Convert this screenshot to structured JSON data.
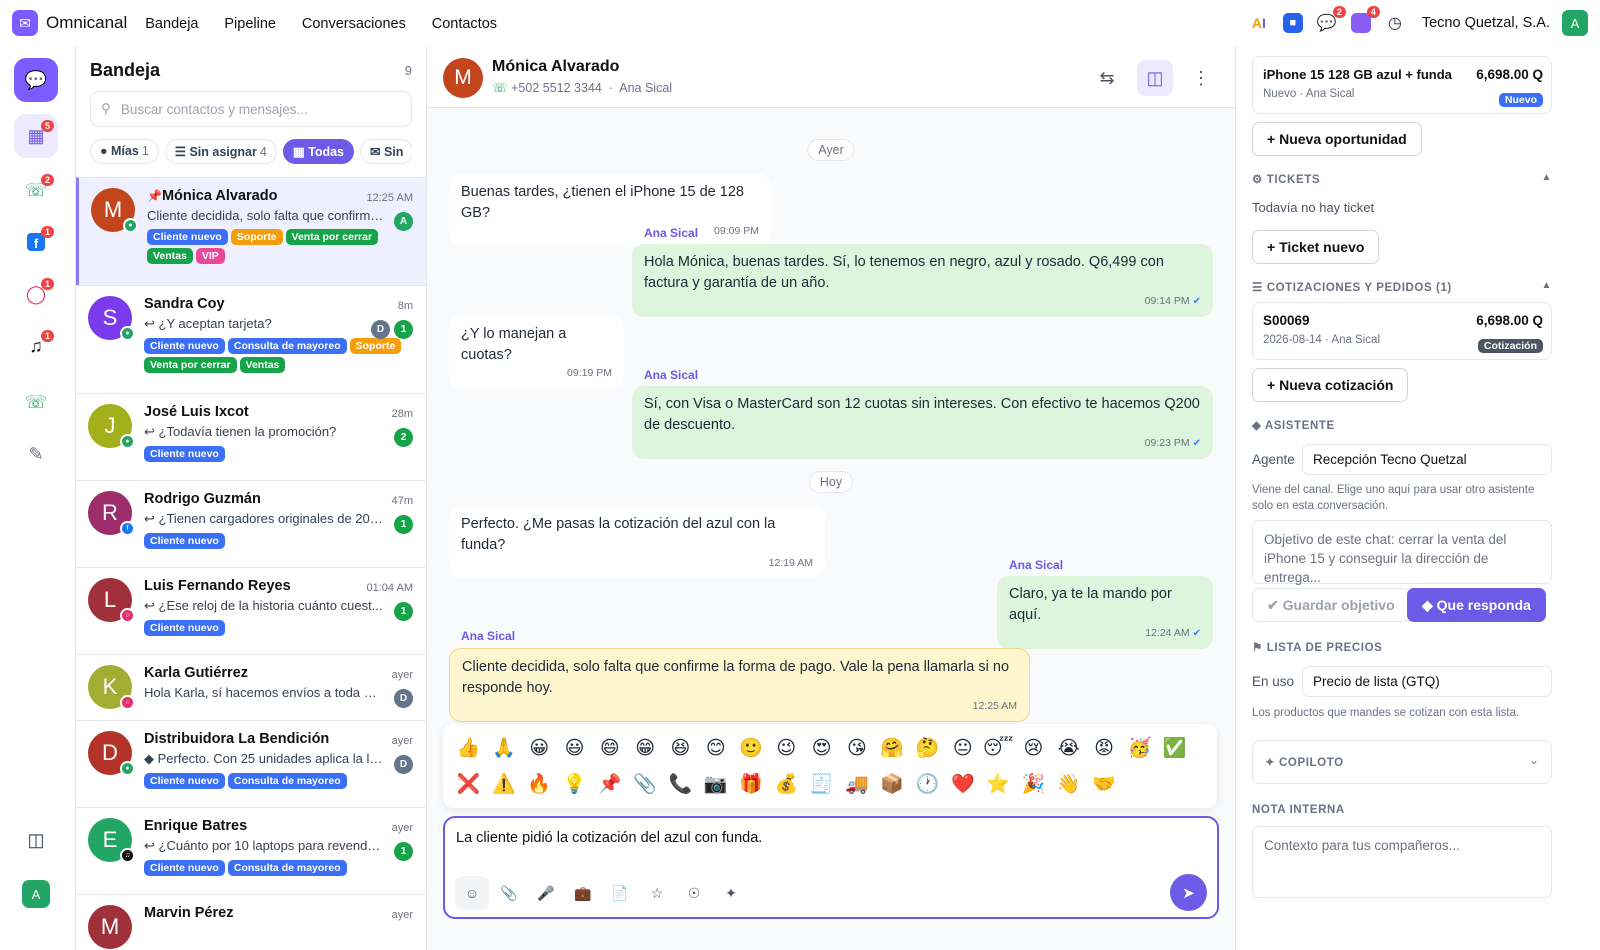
{
  "topbar": {
    "brand": "Omnicanal",
    "nav": [
      "Bandeja",
      "Pipeline",
      "Conversaciones",
      "Contactos"
    ],
    "chat_badge": "2",
    "inbox_badge": "4",
    "org": "Tecno Quetzal, S.A.",
    "user_initial": "A"
  },
  "rail": {
    "dashboard_badge": "5",
    "whatsapp_badge": "2",
    "facebook_badge": "1",
    "instagram_badge": "1",
    "tiktok_badge": "1",
    "user_initial": "A"
  },
  "inbox": {
    "title": "Bandeja",
    "count": "9",
    "search_placeholder": "Buscar contactos y mensajes...",
    "filters": [
      {
        "label": "Mías",
        "n": "1"
      },
      {
        "label": "Sin asignar",
        "n": "4"
      },
      {
        "label": "Todas",
        "n": ""
      },
      {
        "label": "Sin",
        "n": ""
      }
    ],
    "conversations": [
      {
        "initial": "M",
        "name": "Mónica Alvarado",
        "time": "12:25 AM",
        "preview": "Cliente decidida, solo falta que confirme...",
        "badges": [
          "A"
        ],
        "tags": [
          "Cliente nuevo",
          "Soporte",
          "Venta por cerrar",
          "Ventas",
          "VIP"
        ]
      },
      {
        "initial": "S",
        "name": "Sandra Coy",
        "time": "8m",
        "preview": "¿Y aceptan tarjeta?",
        "badges": [
          "D",
          "1"
        ],
        "tags": [
          "Cliente nuevo",
          "Consulta de mayoreo",
          "Soporte",
          "Venta por cerrar",
          "Ventas"
        ]
      },
      {
        "initial": "J",
        "name": "José Luis Ixcot",
        "time": "28m",
        "preview": "¿Todavía tienen la promoción?",
        "badges": [
          "2"
        ],
        "tags": [
          "Cliente nuevo"
        ]
      },
      {
        "initial": "R",
        "name": "Rodrigo Guzmán",
        "time": "47m",
        "preview": "¿Tienen cargadores originales de 20 ...",
        "badges": [
          "1"
        ],
        "tags": [
          "Cliente nuevo"
        ]
      },
      {
        "initial": "L",
        "name": "Luis Fernando Reyes",
        "time": "01:04 AM",
        "preview": "¿Ese reloj de la historia cuánto cuest...",
        "badges": [
          "1"
        ],
        "tags": [
          "Cliente nuevo"
        ]
      },
      {
        "initial": "K",
        "name": "Karla Gutiérrez",
        "time": "ayer",
        "preview": "Hola Karla, sí hacemos envíos a toda Gu...",
        "badges": [
          "D"
        ],
        "tags": []
      },
      {
        "initial": "D",
        "name": "Distribuidora La Bendición",
        "time": "ayer",
        "preview": "Perfecto. Con 25 unidades aplica la lis...",
        "badges": [
          "D"
        ],
        "tags": [
          "Cliente nuevo",
          "Consulta de mayoreo"
        ]
      },
      {
        "initial": "E",
        "name": "Enrique Batres",
        "time": "ayer",
        "preview": "¿Cuánto por 10 laptops para revende...",
        "badges": [
          "1"
        ],
        "tags": [
          "Cliente nuevo",
          "Consulta de mayoreo"
        ]
      },
      {
        "initial": "M",
        "name": "Marvin Pérez",
        "time": "ayer",
        "preview": "",
        "badges": [],
        "tags": []
      }
    ]
  },
  "chat": {
    "contact_initial": "M",
    "contact_name": "Mónica Alvarado",
    "phone": "+502 5512 3344",
    "agent": "Ana Sical",
    "sep": "·",
    "day1": "Ayer",
    "day2": "Hoy",
    "messages": [
      {
        "text": "Buenas tardes, ¿tienen el iPhone 15 de 128 GB?",
        "time": "09:09 PM"
      },
      {
        "sender": "Ana Sical",
        "text": "Hola Mónica, buenas tardes. Sí, lo tenemos en negro, azul y rosado. Q6,499 con factura y garantía de un año.",
        "time": "09:14 PM"
      },
      {
        "text": "¿Y lo manejan a cuotas?",
        "time": "09:19 PM"
      },
      {
        "sender": "Ana Sical",
        "text": "Sí, con Visa o MasterCard son 12 cuotas sin intereses. Con efectivo te hacemos Q200 de descuento.",
        "time": "09:23 PM"
      },
      {
        "text": "Perfecto. ¿Me pasas la cotización del azul con la funda?",
        "time": "12:19 AM"
      },
      {
        "sender": "Ana Sical",
        "text": "Claro, ya te la mando por aquí.",
        "time": "12:24 AM"
      },
      {
        "sender": "Ana Sical",
        "text": "Cliente decidida, solo falta que confirme la forma de pago. Vale la pena llamarla si no responde hoy.",
        "time": "12:25 AM"
      }
    ],
    "emojis": [
      "👍",
      "🙏",
      "😀",
      "😃",
      "😄",
      "😁",
      "😆",
      "😊",
      "🙂",
      "😉",
      "😍",
      "😘",
      "🤗",
      "🤔",
      "😐",
      "😴",
      "😢",
      "😭",
      "😡",
      "🥳",
      "✅",
      "❌",
      "⚠️",
      "🔥",
      "💡",
      "📌",
      "📎",
      "📞",
      "📷",
      "🎁",
      "💰",
      "🧾",
      "🚚",
      "📦",
      "🕐",
      "❤️",
      "⭐",
      "🎉",
      "👋",
      "🤝"
    ],
    "composer_text": "La cliente pidió la cotización del azul con funda."
  },
  "side": {
    "opp_name": "iPhone 15 128 GB azul + funda",
    "opp_amount": "6,698.00 Q",
    "opp_meta": "Nuevo · Ana Sical",
    "opp_badge": "Nuevo",
    "new_opp": "Nueva oportunidad",
    "tickets_title": "TICKETS",
    "tickets_empty": "Todavía no hay ticket",
    "new_ticket": "Ticket nuevo",
    "quotes_title": "COTIZACIONES Y PEDIDOS (1)",
    "quote_id": "S00069",
    "quote_amount": "6,698.00 Q",
    "quote_meta": "2026-08-14 · Ana Sical",
    "quote_badge": "Cotización",
    "new_quote": "Nueva cotización",
    "assistant_title": "ASISTENTE",
    "agent_label": "Agente",
    "agent_value": "Recepción Tecno Quetzal",
    "agent_hint": "Viene del canal. Elige uno aquí para usar otro asistente solo en esta conversación.",
    "goal_placeholder": "Objetivo de este chat: cerrar la venta del iPhone 15 y conseguir la dirección de entrega...",
    "save_goal": "Guardar objetivo",
    "respond": "Que responda",
    "pricelist_title": "LISTA DE PRECIOS",
    "pricelist_label": "En uso",
    "pricelist_value": "Precio de lista (GTQ)",
    "pricelist_hint": "Los productos que mandes se cotizan con esta lista.",
    "copilot_title": "COPILOTO",
    "note_title": "NOTA INTERNA",
    "note_placeholder": "Contexto para tus compañeros..."
  },
  "colors": {
    "accent": "#6d5ae6",
    "tag_blue": "#3b6ff5",
    "tag_orange": "#f59e0b",
    "tag_green": "#16a34a",
    "tag_pink": "#ec4899",
    "out_bubble": "#dcf5dc",
    "note_bubble": "#fef6cf"
  }
}
